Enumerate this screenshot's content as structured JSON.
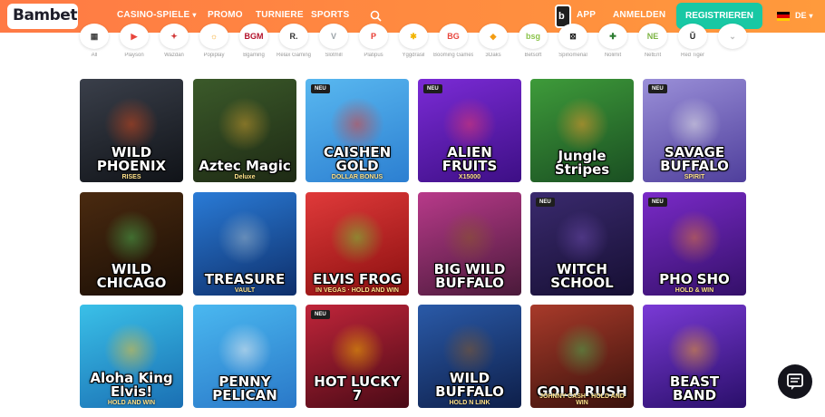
{
  "header": {
    "logo": "Bambet",
    "nav": [
      {
        "label": "CASINO-SPIELE"
      },
      {
        "label": "PROMO"
      },
      {
        "label": "TURNIERE"
      },
      {
        "label": "SPORTS"
      }
    ],
    "app_label": "APP",
    "login_label": "ANMELDEN",
    "register_label": "REGISTRIEREN",
    "language": "DE",
    "accent_color": "#ff8a40",
    "register_color": "#18c8a4"
  },
  "providers": [
    {
      "short": "▦",
      "name": "All",
      "color": "#444444"
    },
    {
      "short": "▶",
      "name": "Playson",
      "color": "#e8453c"
    },
    {
      "short": "✦",
      "name": "Wazdan",
      "color": "#d23c3c"
    },
    {
      "short": "☼",
      "name": "Popiplay",
      "color": "#f5a623"
    },
    {
      "short": "BGM",
      "name": "Bgaming",
      "color": "#b3102a"
    },
    {
      "short": "R.",
      "name": "Relax Gaming",
      "color": "#333333"
    },
    {
      "short": "V",
      "name": "Slotmill",
      "color": "#9aa3a8"
    },
    {
      "short": "P",
      "name": "Platipus",
      "color": "#e83a30"
    },
    {
      "short": "✱",
      "name": "Yggdrasil",
      "color": "#f2b400"
    },
    {
      "short": "BG",
      "name": "Booming Games",
      "color": "#e8453c"
    },
    {
      "short": "◆",
      "name": "3Oaks",
      "color": "#f39c12"
    },
    {
      "short": "bsg",
      "name": "Betsoft",
      "color": "#8bc34a"
    },
    {
      "short": "⊠",
      "name": "Spinomenal",
      "color": "#222222"
    },
    {
      "short": "✚",
      "name": "Nolimit",
      "color": "#2e7d32"
    },
    {
      "short": "NE",
      "name": "NetEnt",
      "color": "#7cb342"
    },
    {
      "short": "Ŭ",
      "name": "Red Tiger",
      "color": "#222222"
    },
    {
      "short": "⌄",
      "name": "",
      "color": "#bbbbbb"
    }
  ],
  "games": [
    {
      "title": "WILD PHOENIX",
      "sub": "RISES",
      "badge": "",
      "bg1": "#3a3f4a",
      "bg2": "#101318",
      "art": "#d24a1f"
    },
    {
      "title": "Aztec Magic",
      "sub": "Deluxe",
      "badge": "",
      "bg1": "#3b5a2a",
      "bg2": "#1e2a14",
      "art": "#c99a2e"
    },
    {
      "title": "CAISHEN GOLD",
      "sub": "DOLLAR BONUS",
      "badge": "NEU",
      "bg1": "#59b8f0",
      "bg2": "#2c7fd1",
      "art": "#e23a2e"
    },
    {
      "title": "ALIEN FRUITS",
      "sub": "X15000",
      "badge": "NEU",
      "bg1": "#7b2bd6",
      "bg2": "#3d0f85",
      "art": "#e83b6c"
    },
    {
      "title": "Jungle Stripes",
      "sub": "",
      "badge": "",
      "bg1": "#3e9b3a",
      "bg2": "#1a4f22",
      "art": "#f29a2e"
    },
    {
      "title": "SAVAGE BUFFALO",
      "sub": "SPIRIT",
      "badge": "NEU",
      "bg1": "#9a8fd8",
      "bg2": "#4f3f9c",
      "art": "#e8e8e8"
    },
    {
      "title": "WILD CHICAGO",
      "sub": "",
      "badge": "",
      "bg1": "#4a2a10",
      "bg2": "#1a0e05",
      "art": "#4caf50"
    },
    {
      "title": "TREASURE",
      "sub": "VAULT",
      "badge": "",
      "bg1": "#2a7bd6",
      "bg2": "#0e2f6b",
      "art": "#9fb6c9"
    },
    {
      "title": "ELVIS FROG",
      "sub": "IN VEGAS · HOLD AND WIN",
      "badge": "",
      "bg1": "#e03a3a",
      "bg2": "#8a0f0f",
      "art": "#6fd13a"
    },
    {
      "title": "BIG WILD BUFFALO",
      "sub": "",
      "badge": "",
      "bg1": "#b83a8a",
      "bg2": "#4a1a3a",
      "art": "#8a5a2a"
    },
    {
      "title": "WITCH SCHOOL",
      "sub": "",
      "badge": "NEU",
      "bg1": "#3a2a6e",
      "bg2": "#160f33",
      "art": "#6a4aaa"
    },
    {
      "title": "PHO SHO",
      "sub": "HOLD & WIN",
      "badge": "NEU",
      "bg1": "#7a2ac8",
      "bg2": "#341069",
      "art": "#e07a3a"
    },
    {
      "title": "Aloha King Elvis!",
      "sub": "HOLD AND WIN",
      "badge": "",
      "bg1": "#3ac0e8",
      "bg2": "#1a6fb3",
      "art": "#f2c12e"
    },
    {
      "title": "PENNY PELICAN",
      "sub": "",
      "badge": "",
      "bg1": "#4ab8f0",
      "bg2": "#2a78c8",
      "art": "#f0f0f0"
    },
    {
      "title": "HOT LUCKY 7",
      "sub": "",
      "badge": "NEU",
      "bg1": "#c0253a",
      "bg2": "#4a0a16",
      "art": "#f2b400"
    },
    {
      "title": "WILD BUFFALO",
      "sub": "HOLD N LINK",
      "badge": "",
      "bg1": "#2a5aa8",
      "bg2": "#0e1f4a",
      "art": "#8a5a2a"
    },
    {
      "title": "GOLD RUSH",
      "sub": "JOHNNY CASH · HOLD AND WIN",
      "badge": "",
      "bg1": "#a83a2a",
      "bg2": "#3a120c",
      "art": "#4caf50"
    },
    {
      "title": "BEAST BAND",
      "sub": "",
      "badge": "",
      "bg1": "#7a3ad6",
      "bg2": "#2a0f6a",
      "art": "#f2a12e"
    }
  ]
}
